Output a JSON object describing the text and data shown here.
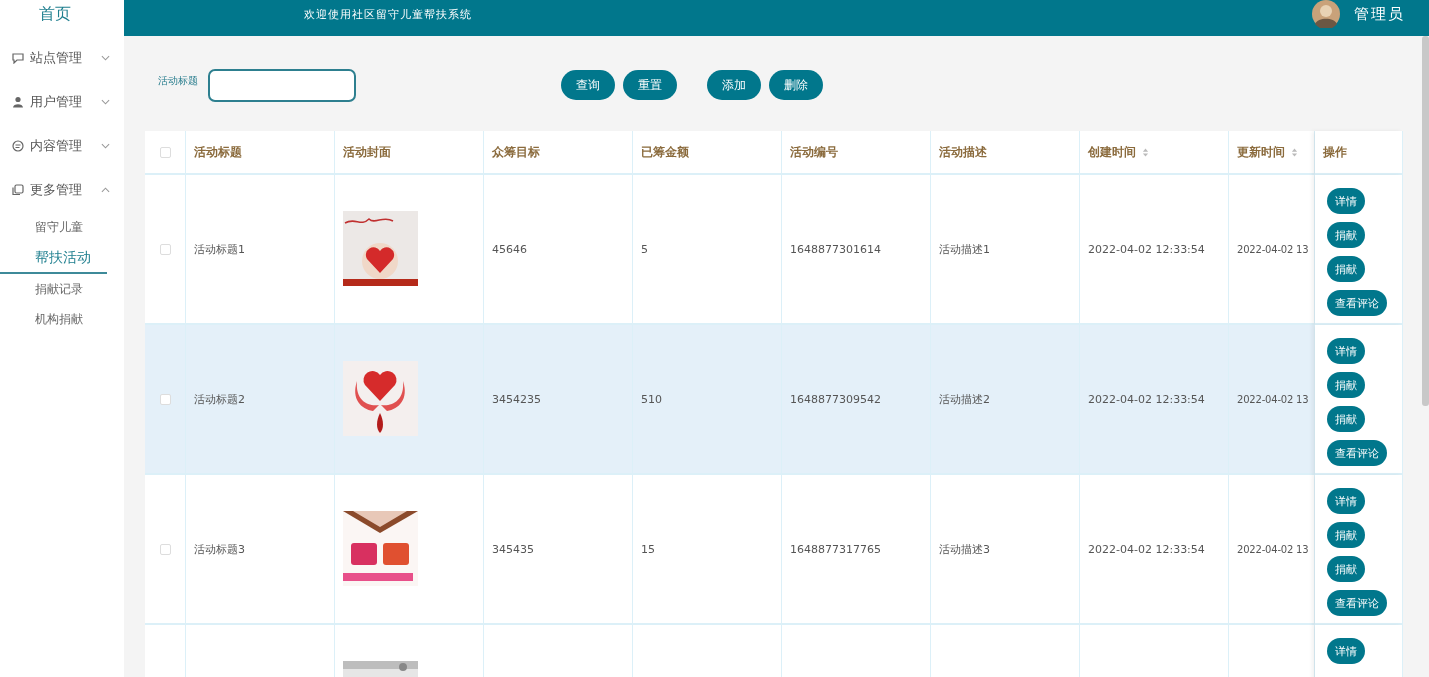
{
  "sidebar": {
    "home": "首页",
    "menus": [
      {
        "label": "站点管理",
        "expanded": false
      },
      {
        "label": "用户管理",
        "expanded": false
      },
      {
        "label": "内容管理",
        "expanded": false
      },
      {
        "label": "更多管理",
        "expanded": true,
        "children": [
          {
            "label": "留守儿童",
            "selected": false
          },
          {
            "label": "帮扶活动",
            "selected": true
          },
          {
            "label": "捐献记录",
            "selected": false
          },
          {
            "label": "机构捐献",
            "selected": false
          }
        ]
      }
    ]
  },
  "header": {
    "title": "欢迎使用社区留守儿童帮扶系统",
    "user": "管理员"
  },
  "search": {
    "label": "活动标题"
  },
  "toolbar": {
    "left": [
      "查询",
      "重置"
    ],
    "right": [
      "添加",
      "删除"
    ]
  },
  "table": {
    "select_all": {
      "checked": false
    },
    "columns": [
      {
        "label": "活动标题",
        "sortable": false
      },
      {
        "label": "活动封面",
        "sortable": false
      },
      {
        "label": "众筹目标",
        "sortable": false
      },
      {
        "label": "已筹金额",
        "sortable": false
      },
      {
        "label": "活动编号",
        "sortable": false
      },
      {
        "label": "活动描述",
        "sortable": false
      },
      {
        "label": "创建时间",
        "sortable": true
      },
      {
        "label": "更新时间",
        "sortable": true
      },
      {
        "label": "操作",
        "sortable": false
      }
    ],
    "rows": [
      {
        "checked": false,
        "highlighted": false,
        "cover": {
          "kind": "picture"
        },
        "cells": [
          "活动标题1",
          "45646",
          "5",
          "1648877301614",
          "活动描述1",
          "2022-04-02 12:33:54",
          "2022-04-02 13"
        ],
        "actions": [
          "详情",
          "捐献",
          "捐献",
          "查看评论"
        ]
      },
      {
        "checked": false,
        "highlighted": true,
        "cover": {
          "kind": "picture"
        },
        "cells": [
          "活动标题2",
          "3454235",
          "510",
          "1648877309542",
          "活动描述2",
          "2022-04-02 12:33:54",
          "2022-04-02 13"
        ],
        "actions": [
          "详情",
          "捐献",
          "捐献",
          "查看评论"
        ]
      },
      {
        "checked": false,
        "highlighted": false,
        "cover": {
          "kind": "picture"
        },
        "cells": [
          "活动标题3",
          "345435",
          "15",
          "1648877317765",
          "活动描述3",
          "2022-04-02 12:33:54",
          "2022-04-02 13"
        ],
        "actions": [
          "详情",
          "捐献",
          "捐献",
          "查看评论"
        ]
      },
      {
        "highlighted": false,
        "cover": {
          "kind": "picture"
        },
        "actions": [
          "详情"
        ]
      }
    ]
  }
}
